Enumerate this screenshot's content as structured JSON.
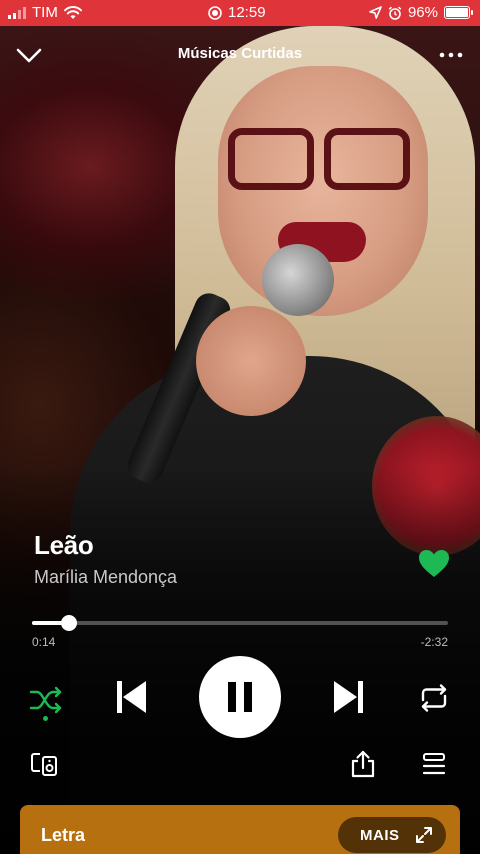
{
  "status_bar": {
    "carrier": "TIM",
    "time": "12:59",
    "battery": "96%"
  },
  "header": {
    "title": "Músicas Curtidas",
    "collapse_icon": "chevron-down-icon",
    "more_icon": "more-horizontal-icon"
  },
  "track": {
    "title": "Leão",
    "artist": "Marília Mendonça",
    "liked": true
  },
  "playback": {
    "elapsed": "0:14",
    "remaining": "-2:32",
    "progress_fraction": 0.09,
    "shuffle_active": true
  },
  "lyrics": {
    "label": "Letra",
    "more_label": "MAIS"
  },
  "colors": {
    "status_bar": "#e0343b",
    "accent_green": "#1db954",
    "lyrics_card": "#b7700f"
  }
}
